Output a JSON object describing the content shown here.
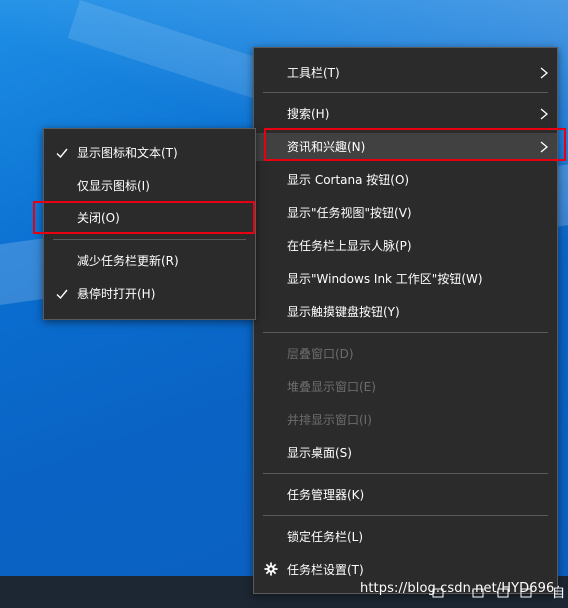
{
  "main_menu": {
    "items": [
      {
        "label": "工具栏(T)",
        "submenu": true,
        "disabled": false
      },
      {
        "label": "搜索(H)",
        "submenu": true,
        "disabled": false
      },
      {
        "label": "资讯和兴趣(N)",
        "submenu": true,
        "disabled": false,
        "highlighted": true
      },
      {
        "label": "显示 Cortana 按钮(O)",
        "submenu": false,
        "disabled": false
      },
      {
        "label": "显示\"任务视图\"按钮(V)",
        "submenu": false,
        "disabled": false
      },
      {
        "label": "在任务栏上显示人脉(P)",
        "submenu": false,
        "disabled": false
      },
      {
        "label": "显示\"Windows Ink 工作区\"按钮(W)",
        "submenu": false,
        "disabled": false
      },
      {
        "label": "显示触摸键盘按钮(Y)",
        "submenu": false,
        "disabled": false
      },
      {
        "label": "层叠窗口(D)",
        "submenu": false,
        "disabled": true
      },
      {
        "label": "堆叠显示窗口(E)",
        "submenu": false,
        "disabled": true
      },
      {
        "label": "并排显示窗口(I)",
        "submenu": false,
        "disabled": true
      },
      {
        "label": "显示桌面(S)",
        "submenu": false,
        "disabled": false
      },
      {
        "label": "任务管理器(K)",
        "submenu": false,
        "disabled": false
      },
      {
        "label": "锁定任务栏(L)",
        "submenu": false,
        "disabled": false
      },
      {
        "label": "任务栏设置(T)",
        "submenu": false,
        "disabled": false,
        "icon": "gear-icon"
      }
    ]
  },
  "sub_menu": {
    "items": [
      {
        "label": "显示图标和文本(T)",
        "checked": true
      },
      {
        "label": "仅显示图标(I)",
        "checked": false
      },
      {
        "label": "关闭(O)",
        "checked": false,
        "highlighted": true
      },
      {
        "label": "减少任务栏更新(R)",
        "checked": false
      },
      {
        "label": "悬停时打开(H)",
        "checked": true
      }
    ]
  },
  "watermark": {
    "text": "https://blog.csdn.net/HYD696"
  },
  "tray": {
    "char": "自"
  },
  "colors": {
    "menu_bg": "#2b2b2b",
    "menu_border": "#5a5a5a",
    "highlight_border": "#e60012",
    "desktop_blue": "#0a6ed0",
    "taskbar": "#1d2733"
  }
}
